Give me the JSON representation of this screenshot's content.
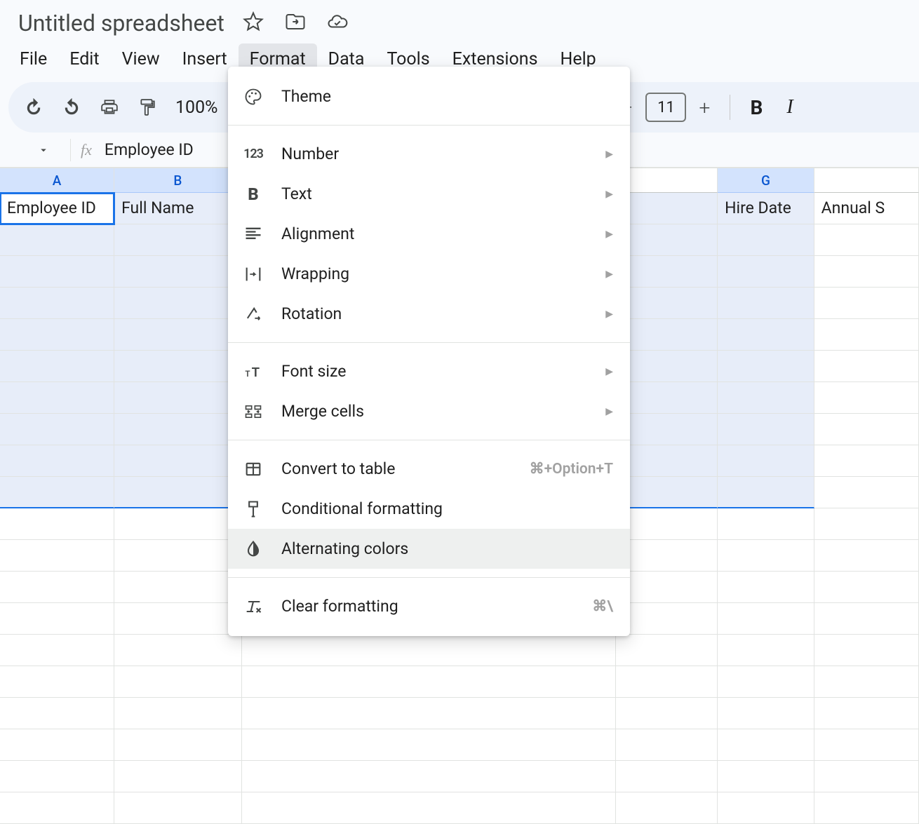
{
  "doc": {
    "title": "Untitled spreadsheet"
  },
  "menubar": [
    "File",
    "Edit",
    "View",
    "Insert",
    "Format",
    "Data",
    "Tools",
    "Extensions",
    "Help"
  ],
  "menubar_active_index": 4,
  "toolbar": {
    "zoom": "100%",
    "font_size": "11"
  },
  "formula_bar": {
    "text": "Employee ID"
  },
  "columns": [
    "A",
    "B",
    "",
    "",
    "",
    "",
    "G",
    ""
  ],
  "selected_columns": [
    "A",
    "B",
    "G"
  ],
  "row1": {
    "A": "Employee ID",
    "B": "Full Name",
    "G": "Hire Date",
    "H": "Annual S"
  },
  "selected_rows_count": 10,
  "dropdown": {
    "sections": [
      [
        {
          "label": "Theme",
          "icon": "palette-icon",
          "submenu": false
        }
      ],
      [
        {
          "label": "Number",
          "icon": "number-123-icon",
          "submenu": true
        },
        {
          "label": "Text",
          "icon": "bold-icon",
          "submenu": true
        },
        {
          "label": "Alignment",
          "icon": "align-left-icon",
          "submenu": true
        },
        {
          "label": "Wrapping",
          "icon": "wrap-text-icon",
          "submenu": true
        },
        {
          "label": "Rotation",
          "icon": "rotate-text-icon",
          "submenu": true
        }
      ],
      [
        {
          "label": "Font size",
          "icon": "font-size-icon",
          "submenu": true
        },
        {
          "label": "Merge cells",
          "icon": "merge-cells-icon",
          "submenu": true
        }
      ],
      [
        {
          "label": "Convert to table",
          "icon": "table-icon",
          "submenu": false,
          "shortcut": "⌘+Option+T"
        },
        {
          "label": "Conditional formatting",
          "icon": "conditional-format-icon",
          "submenu": false
        },
        {
          "label": "Alternating colors",
          "icon": "alternating-colors-icon",
          "submenu": false,
          "hover": true
        }
      ],
      [
        {
          "label": "Clear formatting",
          "icon": "clear-format-icon",
          "submenu": false,
          "shortcut": "⌘\\"
        }
      ]
    ]
  }
}
